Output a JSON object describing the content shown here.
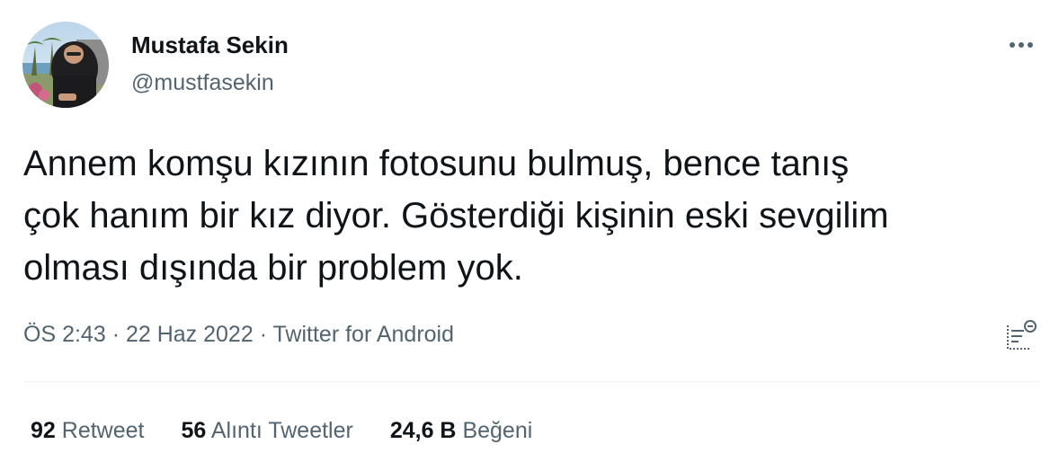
{
  "user": {
    "name": "Mustafa Sekin",
    "handle": "@mustfasekin"
  },
  "tweet": {
    "lines": [
      "Annem komşu kızının fotosunu bulmuş, bence tanış",
      "çok hanım bir kız diyor. Gösterdiği kişinin eski sevgilim",
      "olması dışında bir problem yok."
    ],
    "time": "ÖS 2:43",
    "date": "22 Haz 2022",
    "source": "Twitter for Android",
    "separator": "·"
  },
  "stats": {
    "retweets": {
      "count": "92",
      "label": "Retweet"
    },
    "quotes": {
      "count": "56",
      "label": "Alıntı Tweetler"
    },
    "likes": {
      "count": "24,6 B",
      "label": "Beğeni"
    }
  },
  "colors": {
    "text_primary": "#0f1419",
    "text_secondary": "#536471",
    "divider": "#eff3f4"
  },
  "icons": {
    "more": "more-dots-icon",
    "analytics": "analytics-icon"
  }
}
